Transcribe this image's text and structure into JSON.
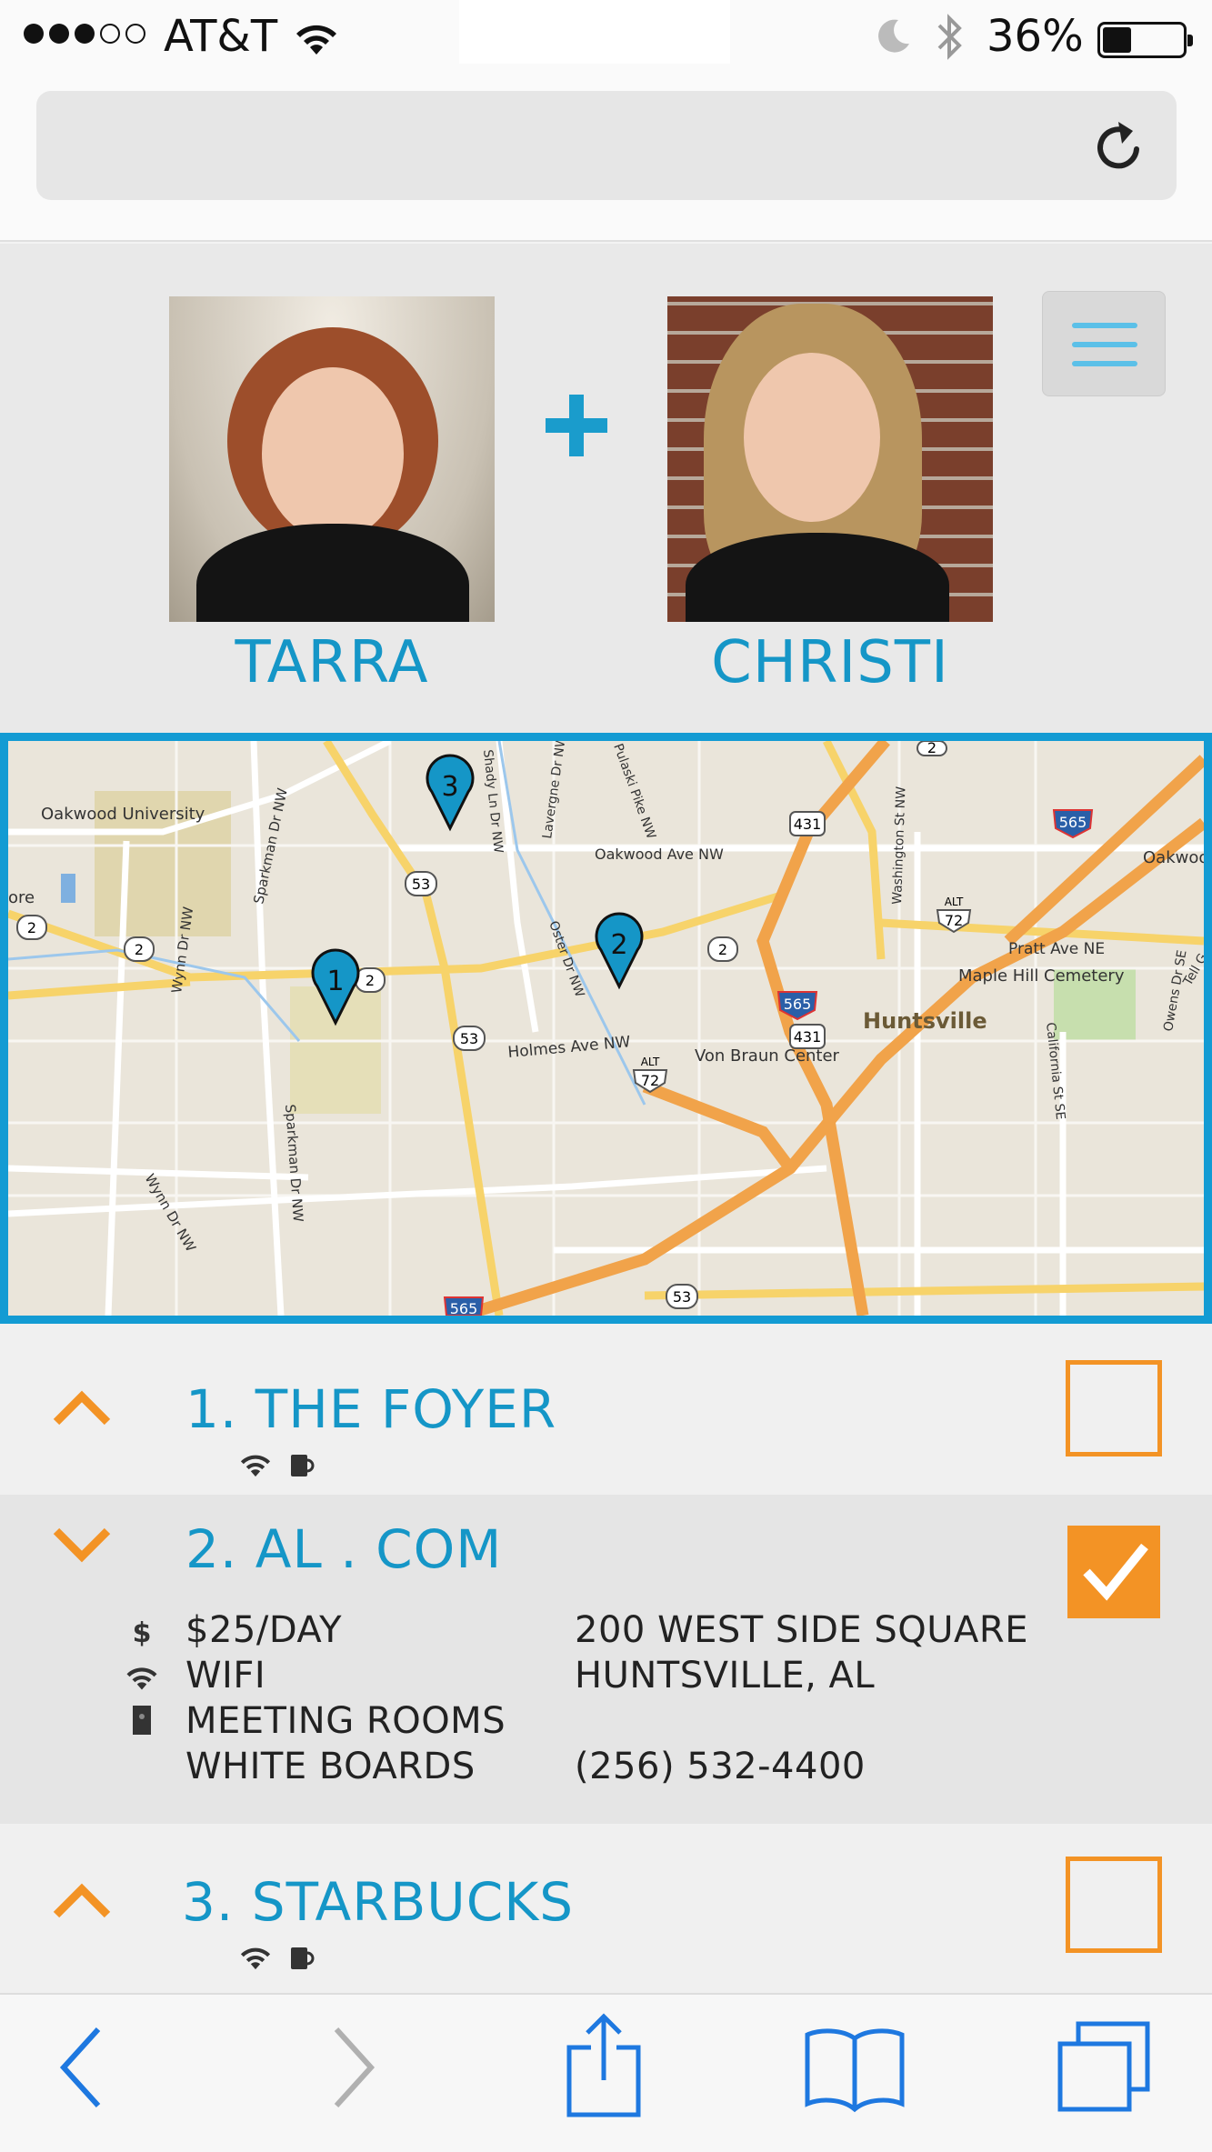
{
  "status_bar": {
    "carrier": "AT&T",
    "battery": "36%",
    "battery_level": 0.36,
    "signal_bars_filled": 3,
    "signal_bars_total": 5
  },
  "header": {
    "person1": "TARRA",
    "person2": "CHRISTI",
    "plus": "+"
  },
  "map": {
    "labels": {
      "oakwood_university": "Oakwood University",
      "oakwood_ave": "Oakwood Ave NW",
      "oakwood_right": "Oakwoo",
      "pratt_ave": "Pratt Ave NE",
      "maple_hill": "Maple Hill Cemetery",
      "huntsville": "Huntsville",
      "von_braun": "Von Braun Center",
      "holmes_ave": "Holmes Ave NW",
      "sparkman_top": "Sparkman Dr NW",
      "sparkman_bottom": "Sparkman Dr NW",
      "wynn_top": "Wynn Dr NW",
      "wynn_bottom": "Wynn Dr NW",
      "shady_ln": "Shady Ln Dr NW",
      "lavergne": "Lavergne Dr NW",
      "pulaski": "Pulaski Pike NW",
      "oster": "Oster Dr NW",
      "washington": "Washington St NW",
      "california": "California St SE",
      "owens": "Owens Dr SE",
      "tell": "Tell G",
      "left_edge": "ore"
    },
    "shields": [
      "431",
      "565",
      "53",
      "2",
      "2",
      "2",
      "2",
      "2",
      "72",
      "565",
      "431",
      "53",
      "72",
      "53",
      "565",
      "ALT",
      "ALT"
    ],
    "pins": [
      "1",
      "2",
      "3"
    ]
  },
  "locations": [
    {
      "title": "1. THE FOYER",
      "checked": false,
      "expanded": false,
      "icons": [
        "wifi-icon",
        "coffee-icon"
      ]
    },
    {
      "title": "2. AL . COM",
      "checked": true,
      "expanded": true,
      "features": [
        "$25/DAY",
        "WIFI",
        "MEETING ROOMS",
        "WHITE BOARDS"
      ],
      "address_line1": "200 WEST SIDE SQUARE",
      "address_line2": "HUNTSVILLE, AL",
      "phone": "(256) 532-4400"
    },
    {
      "title": "3. STARBUCKS",
      "checked": false,
      "expanded": false,
      "icons": [
        "wifi-icon",
        "coffee-icon"
      ]
    }
  ],
  "colors": {
    "accent_blue": "#1596c7",
    "accent_orange": "#f39325",
    "map_border": "#139bd3"
  }
}
